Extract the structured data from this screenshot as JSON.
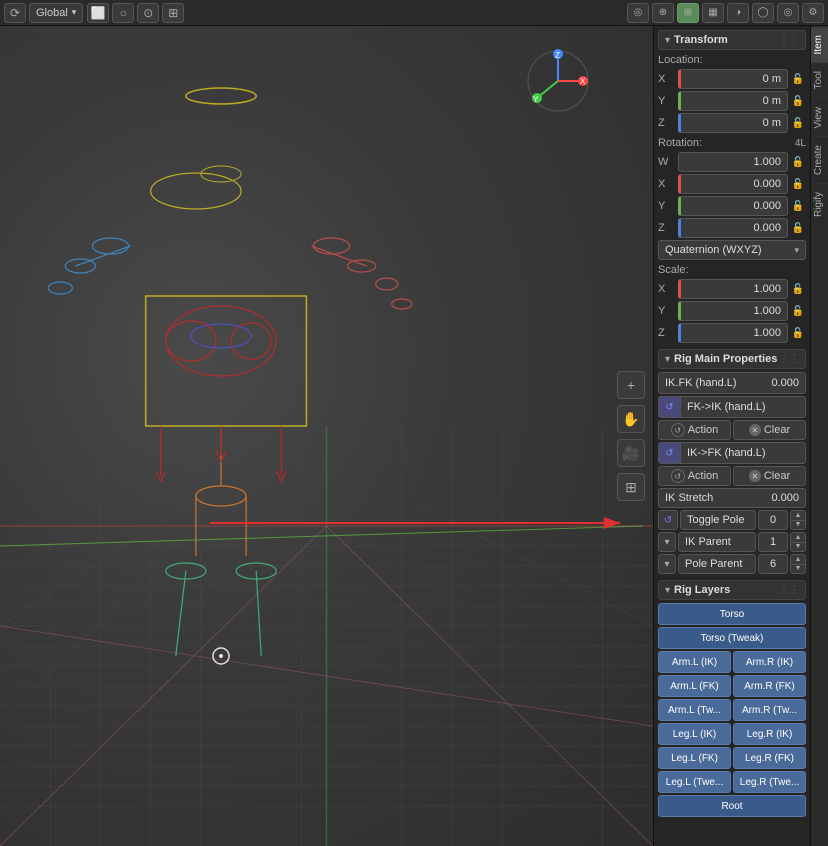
{
  "topbar": {
    "global_label": "Global",
    "transform_buttons": [
      "⟳",
      "⬜",
      "○"
    ],
    "right_icons": [
      "◎",
      "⊕",
      "⊞",
      "▦",
      "◑",
      "◯",
      "◎",
      "⚙"
    ]
  },
  "panel": {
    "tabs": [
      "Item",
      "Tool",
      "View",
      "Create",
      "Rigify"
    ],
    "active_tab": "Item",
    "transform": {
      "header": "Transform",
      "location_label": "Location:",
      "fields_location": [
        {
          "axis": "X",
          "value": "0 m"
        },
        {
          "axis": "Y",
          "value": "0 m"
        },
        {
          "axis": "Z",
          "value": "0 m"
        }
      ],
      "rotation_label": "Rotation:",
      "rotation_mode": "4L",
      "fields_rotation": [
        {
          "axis": "W",
          "value": "1.000"
        },
        {
          "axis": "X",
          "value": "0.000"
        },
        {
          "axis": "Y",
          "value": "0.000"
        },
        {
          "axis": "Z",
          "value": "0.000"
        }
      ],
      "rotation_dropdown": "Quaternion (WXYZ)",
      "scale_label": "Scale:",
      "fields_scale": [
        {
          "axis": "X",
          "value": "1.000"
        },
        {
          "axis": "Y",
          "value": "1.000"
        },
        {
          "axis": "Z",
          "value": "1.000"
        }
      ]
    },
    "rig_main": {
      "header": "Rig Main Properties",
      "ikfk_label": "IK.FK (hand.L)",
      "ikfk_value": "0.000",
      "fk_to_ik_label": "FK->IK (hand.L)",
      "action_label1": "Action",
      "clear_label1": "Clear",
      "ik_to_fk_label": "IK->FK (hand.L)",
      "action_label2": "Action",
      "clear_label2": "Clear",
      "ik_stretch_label": "IK Stretch",
      "ik_stretch_value": "0.000",
      "toggle_pole_label": "Toggle Pole",
      "toggle_pole_value": "0",
      "ik_parent_label": "IK Parent",
      "ik_parent_value": "1",
      "pole_parent_label": "Pole Parent",
      "pole_parent_value": "6"
    },
    "rig_layers": {
      "header": "Rig Layers",
      "buttons": [
        {
          "label": "Torso",
          "full": true,
          "style": "torso"
        },
        {
          "label": "Torso (Tweak)",
          "full": true,
          "style": "tweak"
        },
        {
          "label": "Arm.L (IK)",
          "full": false
        },
        {
          "label": "Arm.R (IK)",
          "full": false
        },
        {
          "label": "Arm.L (FK)",
          "full": false
        },
        {
          "label": "Arm.R (FK)",
          "full": false
        },
        {
          "label": "Arm.L (Tw...",
          "full": false
        },
        {
          "label": "Arm.R (Tw...",
          "full": false
        },
        {
          "label": "Leg.L (IK)",
          "full": false
        },
        {
          "label": "Leg.R (IK)",
          "full": false
        },
        {
          "label": "Leg.L (FK)",
          "full": false
        },
        {
          "label": "Leg.R (FK)",
          "full": false
        },
        {
          "label": "Leg.L (Twe...",
          "full": false
        },
        {
          "label": "Leg.R (Twe...",
          "full": false
        },
        {
          "label": "Root",
          "full": true,
          "style": "root"
        }
      ]
    }
  }
}
